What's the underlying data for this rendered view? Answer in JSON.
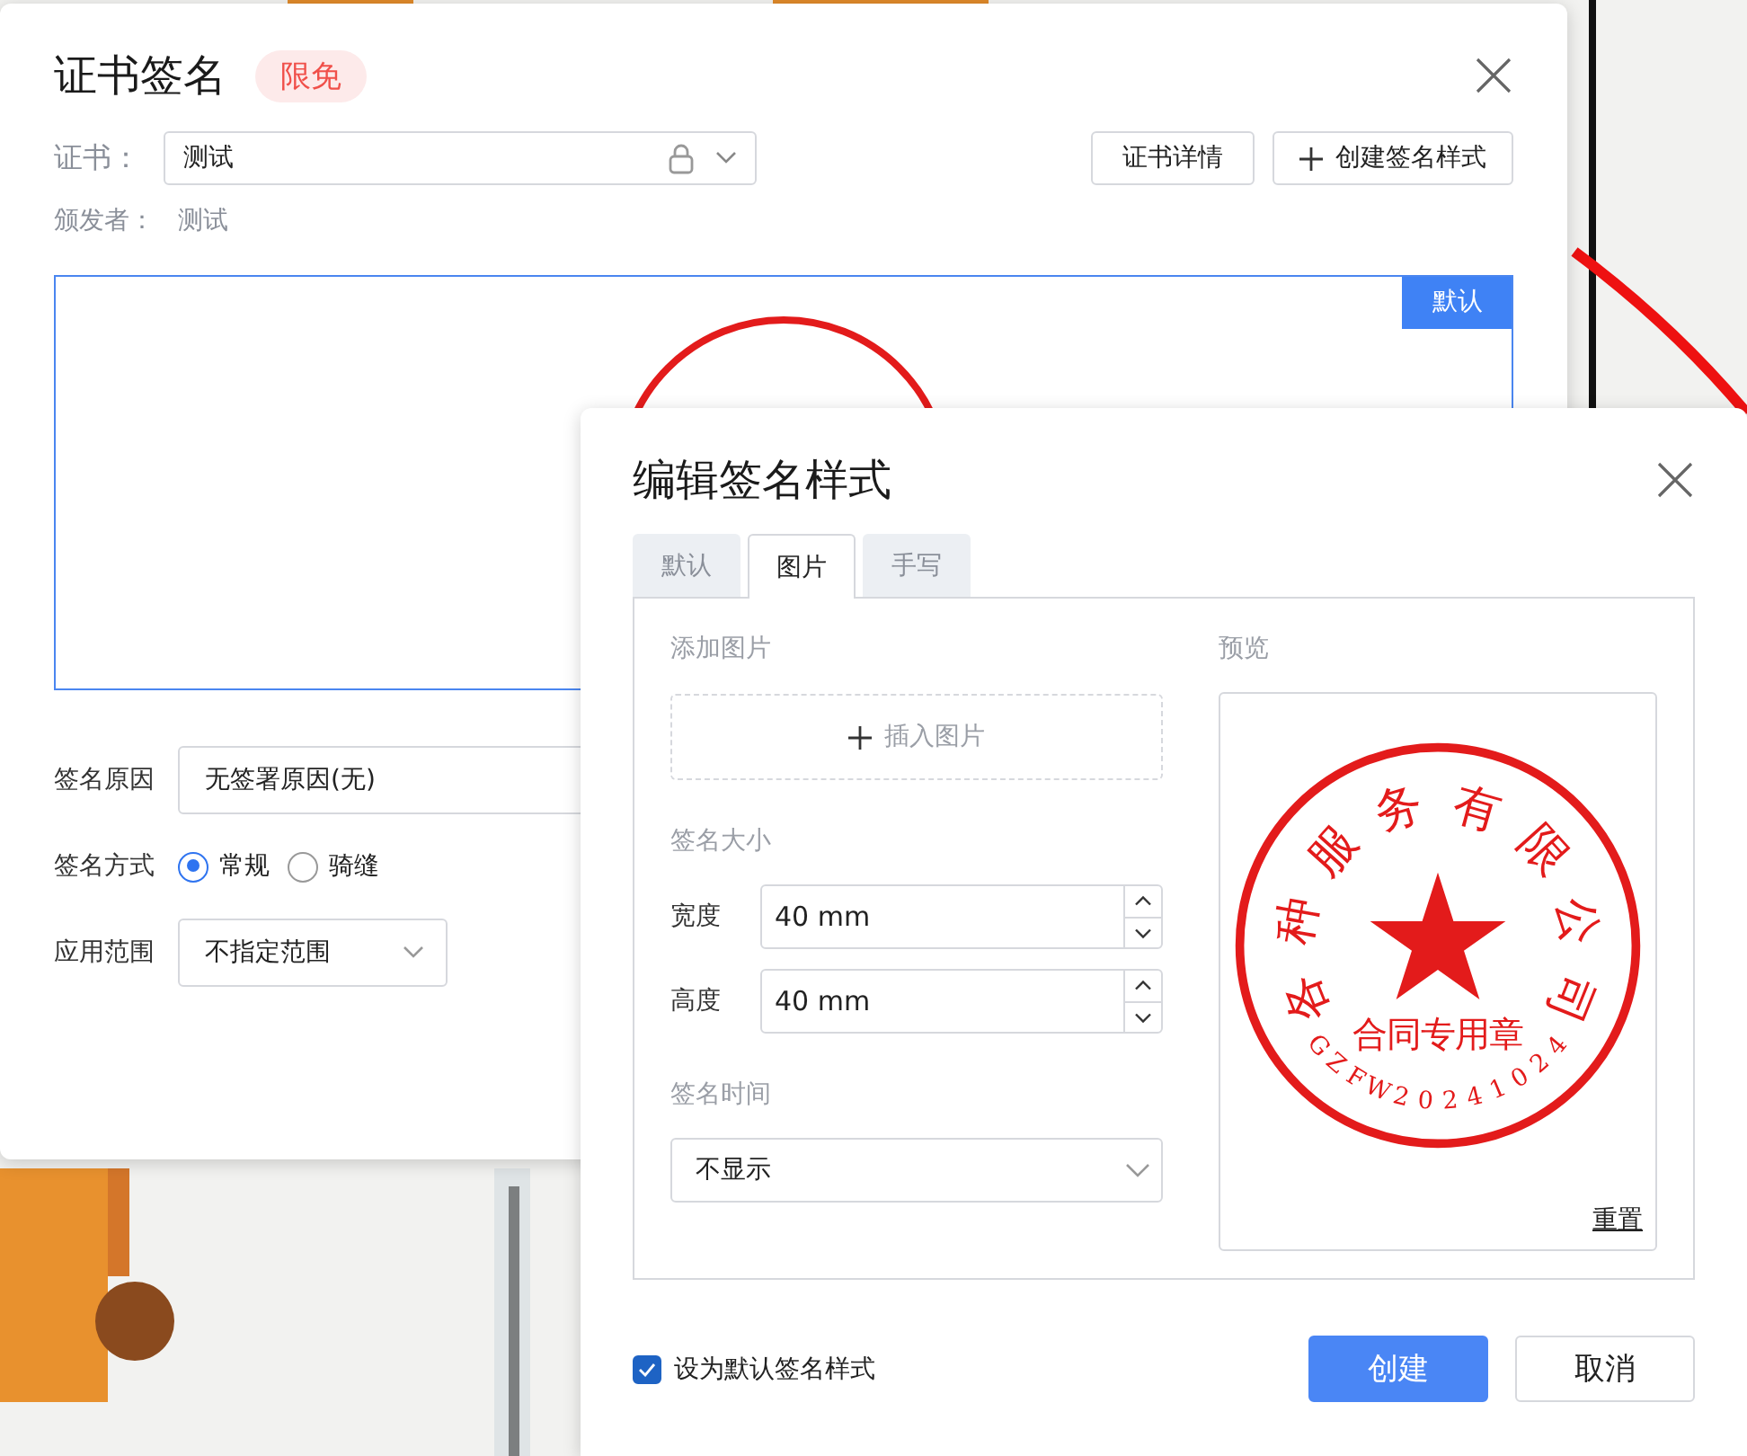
{
  "main_dialog": {
    "title": "证书签名",
    "badge": "限免",
    "certificate": {
      "label": "证书：",
      "value": "测试"
    },
    "buttons": [
      {
        "label": "证书详情",
        "kind": "plain"
      },
      {
        "label": "创建签名样式",
        "kind": "add"
      }
    ],
    "issuer": {
      "label": "颁发者：",
      "value": "测试"
    },
    "preview": {
      "tag": "默认"
    },
    "reason": {
      "label": "签名原因",
      "value": "无签署原因(无)"
    },
    "method": {
      "label": "签名方式",
      "options": [
        {
          "label": "常规",
          "selected": true
        },
        {
          "label": "骑缝",
          "selected": false
        }
      ]
    },
    "scope": {
      "label": "应用范围",
      "value": "不指定范围"
    }
  },
  "style_dialog": {
    "title": "编辑签名样式",
    "tabs": [
      {
        "label": "默认",
        "selected": false
      },
      {
        "label": "图片",
        "selected": true
      },
      {
        "label": "手写",
        "selected": false
      }
    ],
    "add_image": {
      "label": "添加图片",
      "button": "插入图片"
    },
    "size": {
      "label": "签名大小",
      "fields": [
        {
          "label": "宽度",
          "value": "40 mm"
        },
        {
          "label": "高度",
          "value": "40 mm"
        }
      ]
    },
    "time": {
      "label": "签名时间",
      "value": "不显示"
    },
    "preview": {
      "label": "预览",
      "reset": "重置",
      "seal": {
        "name": "各种服务有限公司",
        "purpose": "合同专用章",
        "code": "GZFW20241024"
      }
    },
    "default_checkbox": {
      "label": "设为默认签名样式",
      "checked": true
    },
    "buttons": [
      {
        "label": "创建",
        "kind": "primary"
      },
      {
        "label": "取消",
        "kind": "plain"
      }
    ]
  }
}
